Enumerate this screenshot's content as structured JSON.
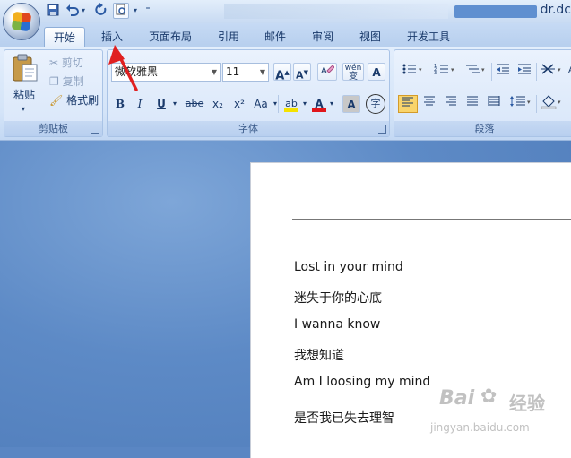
{
  "window": {
    "title": "dr.dc"
  },
  "quick_access": {
    "icons": [
      "save-icon",
      "undo-icon",
      "redo-icon",
      "print-preview-icon"
    ]
  },
  "tabs": [
    {
      "label": "开始",
      "active": true
    },
    {
      "label": "插入",
      "active": false
    },
    {
      "label": "页面布局",
      "active": false
    },
    {
      "label": "引用",
      "active": false
    },
    {
      "label": "邮件",
      "active": false
    },
    {
      "label": "审阅",
      "active": false
    },
    {
      "label": "视图",
      "active": false
    },
    {
      "label": "开发工具",
      "active": false
    }
  ],
  "clipboard": {
    "paste_label": "粘贴",
    "cut_label": "剪切",
    "copy_label": "复制",
    "format_painter_label": "格式刷",
    "group_label": "剪贴板"
  },
  "font": {
    "font_name": "微软雅黑",
    "font_size": "11",
    "bold": "B",
    "italic": "I",
    "underline": "U",
    "strike": "abe",
    "subscript": "x₂",
    "superscript": "x²",
    "change_case": "Aa",
    "highlight": "ab",
    "font_color": "A",
    "char_shading": "A",
    "enclosed": "字",
    "grow": "A",
    "shrink": "A",
    "phonetic": "变",
    "char_border": "A",
    "wen": "wén",
    "group_label": "字体"
  },
  "paragraph": {
    "group_label": "段落"
  },
  "document": {
    "lines": [
      "Lost in your mind",
      "迷失于你的心底",
      "I wanna know",
      "我想知道",
      "Am I loosing my mind",
      "是否我已失去理智"
    ]
  },
  "watermark": {
    "brand": "Bai",
    "brand_cn": "经验",
    "url": "jingyan.baidu.com"
  },
  "colors": {
    "accent_red": "#e02020",
    "highlight_yellow": "#f4e200",
    "font_red": "#e0161b"
  }
}
